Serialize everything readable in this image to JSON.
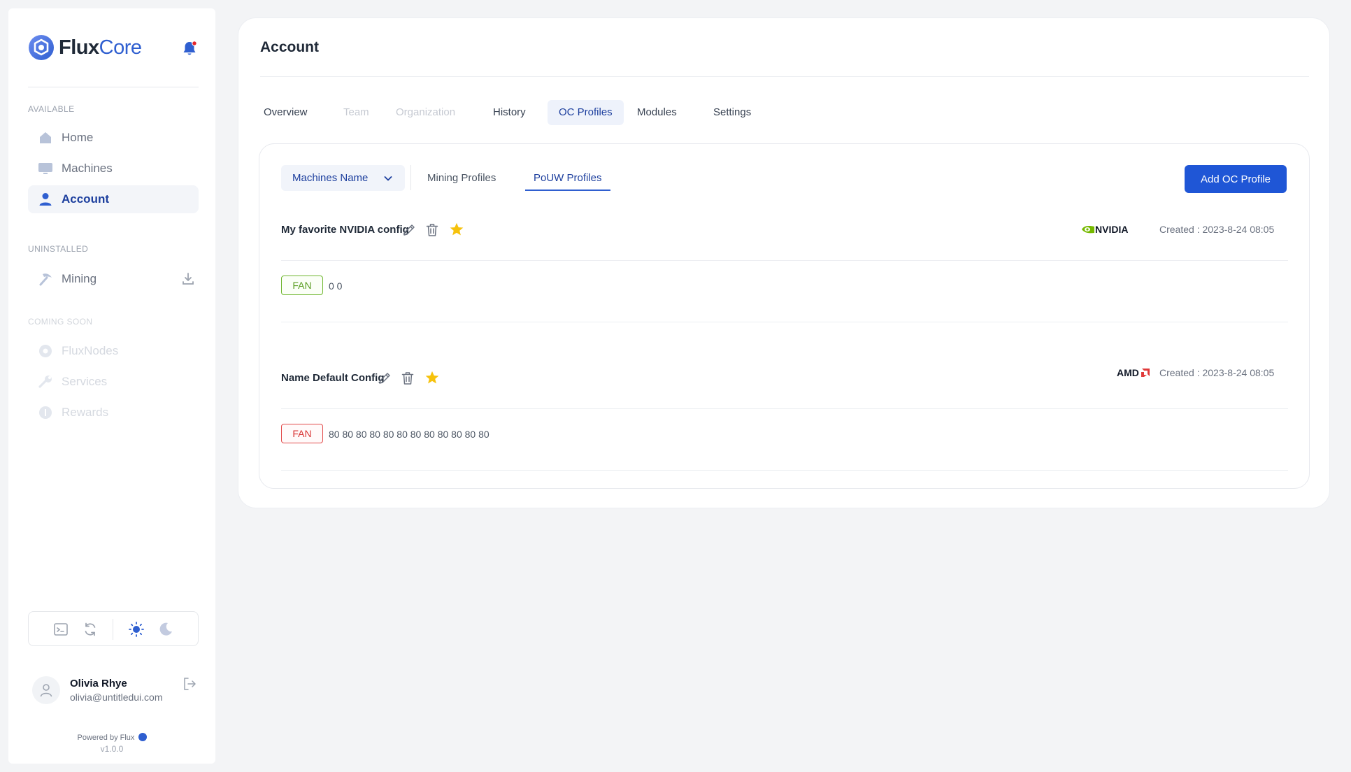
{
  "brand": {
    "name_bold": "Flux",
    "name_light": "Core"
  },
  "sidebar": {
    "sections": {
      "available": "AVAILABLE",
      "uninstalled": "UNINSTALLED",
      "coming_soon": "COMING SOON"
    },
    "items": [
      {
        "label": "Home",
        "icon": "home-icon",
        "state": "normal"
      },
      {
        "label": "Machines",
        "icon": "monitor-icon",
        "state": "normal"
      },
      {
        "label": "Account",
        "icon": "user-icon",
        "state": "active"
      },
      {
        "label": "Mining",
        "icon": "pickaxe-icon",
        "state": "normal",
        "extra_icon": "download-icon"
      },
      {
        "label": "FluxNodes",
        "icon": "fluxnodes-icon",
        "state": "disabled"
      },
      {
        "label": "Services",
        "icon": "wrench-icon",
        "state": "disabled"
      },
      {
        "label": "Rewards",
        "icon": "coin-icon",
        "state": "disabled"
      }
    ],
    "tools": [
      "terminal-icon",
      "refresh-icon",
      "sun-icon",
      "moon-icon"
    ],
    "user": {
      "name": "Olivia Rhye",
      "email": "olivia@untitledui.com"
    },
    "powered_by": "Powered by Flux",
    "version": "v1.0.0"
  },
  "main": {
    "title": "Account",
    "tabs": [
      {
        "label": "Overview",
        "state": "normal"
      },
      {
        "label": "Team",
        "state": "disabled"
      },
      {
        "label": "Organization",
        "state": "disabled"
      },
      {
        "label": "History",
        "state": "normal"
      },
      {
        "label": "OC Profiles",
        "state": "active"
      },
      {
        "label": "Modules",
        "state": "normal"
      },
      {
        "label": "Settings",
        "state": "normal"
      }
    ],
    "panel": {
      "dropdown_label": "Machines Name",
      "subtabs": [
        {
          "label": "Mining Profiles",
          "state": "normal"
        },
        {
          "label": "PoUW Profiles",
          "state": "active"
        }
      ],
      "add_button": "Add OC Profile",
      "profiles": [
        {
          "name": "My favorite NVIDIA config",
          "vendor": "NVIDIA",
          "created": "Created : 2023-8-24 08:05",
          "tag": "FAN",
          "tag_color": "#6fb62f",
          "values": "0 0"
        },
        {
          "name": "Name Default Config",
          "vendor": "AMD",
          "created": "Created : 2023-8-24 08:05",
          "tag": "FAN",
          "tag_color": "#e24b4b",
          "values": "80 80 80 80 80 80 80 80 80 80 80 80"
        }
      ]
    }
  },
  "colors": {
    "accent": "#1f56d6",
    "active_text": "#1d3f9e",
    "star": "#f6c20c",
    "nvidia_green": "#76b900",
    "amd_red": "#e03a3a",
    "notification_dot": "#e5252a"
  }
}
